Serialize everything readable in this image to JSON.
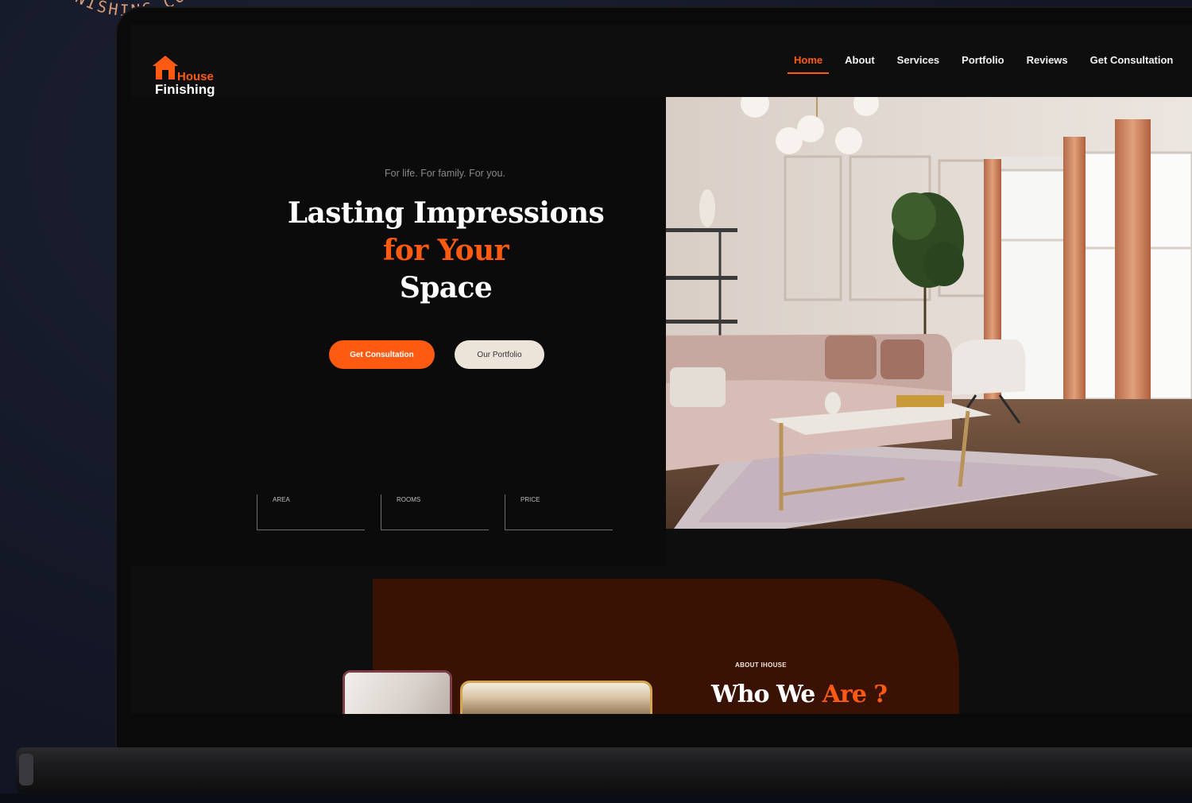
{
  "stamp": {
    "text": "IHOUSE-FINISHING.COM - IHOUSE-FINISHING.COM - "
  },
  "brand": {
    "word1": "House",
    "word2": "Finishing",
    "accent": "#ff5a12"
  },
  "nav": {
    "items": [
      "Home",
      "About",
      "Services",
      "Portfolio",
      "Reviews",
      "Get Consultation"
    ],
    "active": "Home"
  },
  "hero": {
    "tagline": "For life. For family. For you.",
    "line1": "Lasting Impressions",
    "line2": "for Your",
    "line3": "Space",
    "primary_button": "Get Consultation",
    "secondary_button": "Our Portfolio"
  },
  "search": {
    "fields": [
      {
        "label": "AREA"
      },
      {
        "label": "ROOMS"
      },
      {
        "label": "PRICE"
      }
    ]
  },
  "about": {
    "kicker": "ABOUT IHOUSE",
    "title_part1": "Who We",
    "title_part2": "Are ?"
  },
  "colors": {
    "accent": "#ff5a12",
    "panel": "#3a1204",
    "background": "#0e0e0f"
  }
}
